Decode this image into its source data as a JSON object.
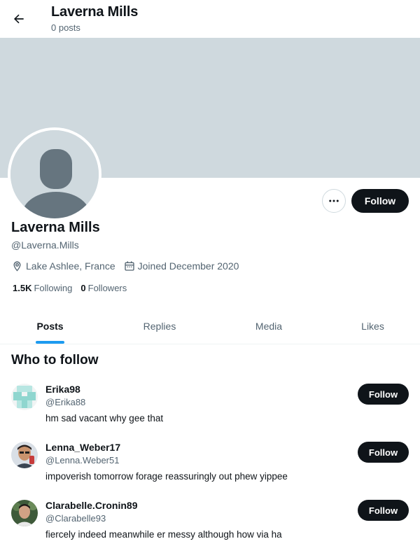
{
  "header": {
    "title": "Laverna Mills",
    "subtitle": "0 posts",
    "back_icon": "arrow-left-icon"
  },
  "profile": {
    "name": "Laverna Mills",
    "handle": "@Laverna.Mills",
    "location": "Lake Ashlee, France",
    "joined": "Joined December 2020",
    "following_count": "1.5K",
    "following_label": "Following",
    "followers_count": "0",
    "followers_label": "Followers",
    "follow_label": "Follow",
    "banner_color": "#cfd9de"
  },
  "tabs": [
    {
      "label": "Posts",
      "active": true
    },
    {
      "label": "Replies",
      "active": false
    },
    {
      "label": "Media",
      "active": false
    },
    {
      "label": "Likes",
      "active": false
    }
  ],
  "who_to_follow": {
    "title": "Who to follow",
    "items": [
      {
        "name": "Erika98",
        "handle": "@Erika88",
        "bio": "hm sad vacant why gee that",
        "follow_label": "Follow"
      },
      {
        "name": "Lenna_Weber17",
        "handle": "@Lenna.Weber51",
        "bio": "impoverish tomorrow forage reassuringly out phew yippee",
        "follow_label": "Follow"
      },
      {
        "name": "Clarabelle.Cronin89",
        "handle": "@Clarabelle93",
        "bio": "fiercely indeed meanwhile er messy although how via ha",
        "follow_label": "Follow"
      }
    ]
  },
  "colors": {
    "accent": "#1d9bf0",
    "text": "#0f1419",
    "muted": "#536471",
    "button": "#0f1419"
  }
}
